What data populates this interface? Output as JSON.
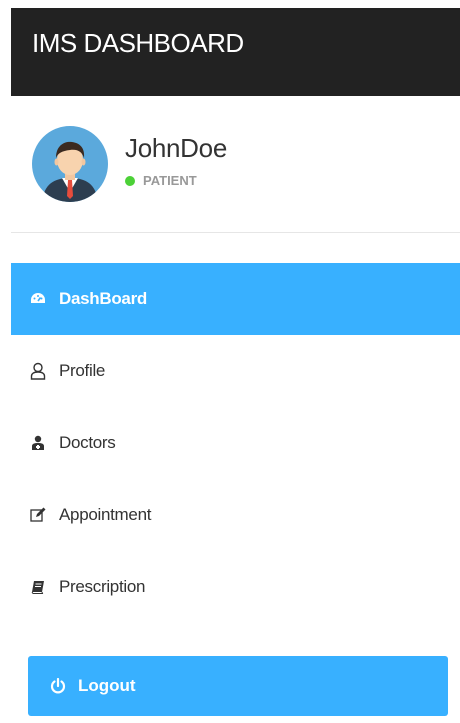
{
  "header": {
    "title": "IMS DASHBOARD"
  },
  "profile": {
    "name": "JohnDoe",
    "role": "PATIENT",
    "status_color": "#4cd137"
  },
  "menu": {
    "items": [
      {
        "label": "DashBoard",
        "icon": "dashboard-icon",
        "active": true
      },
      {
        "label": "Profile",
        "icon": "user-icon",
        "active": false
      },
      {
        "label": "Doctors",
        "icon": "doctor-icon",
        "active": false
      },
      {
        "label": "Appointment",
        "icon": "edit-icon",
        "active": false
      },
      {
        "label": "Prescription",
        "icon": "book-icon",
        "active": false
      }
    ]
  },
  "logout": {
    "label": "Logout",
    "icon": "power-icon"
  },
  "colors": {
    "header_bg": "#222222",
    "accent": "#38b0ff"
  }
}
